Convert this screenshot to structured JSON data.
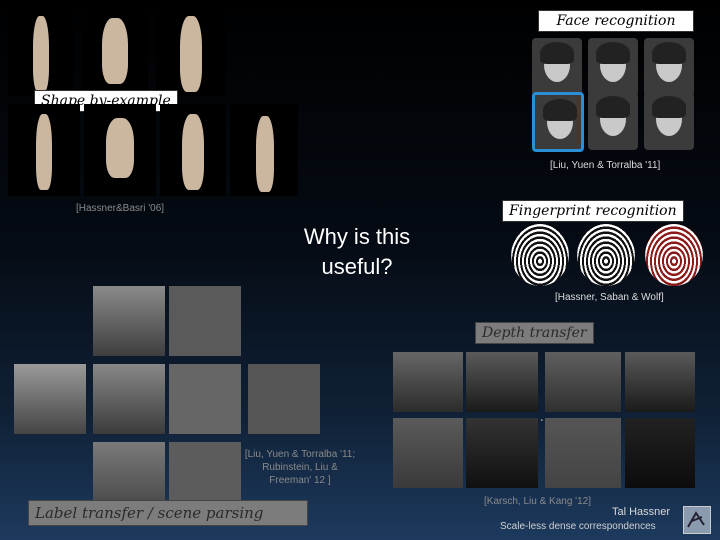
{
  "center_text": "Why is this useful?",
  "shape_example": {
    "caption": "Shape by-example",
    "citation": "[Hassner&Basri '06]"
  },
  "face_recognition": {
    "caption": "Face recognition",
    "citation": "[Liu, Yuen & Torralba '11]"
  },
  "fingerprint": {
    "caption": "Fingerprint recognition",
    "citation": "[Hassner, Saban & Wolf]"
  },
  "depth_transfer": {
    "caption": "Depth transfer",
    "ellipsis": "...",
    "citation": "[Karsch, Liu & Kang '12]"
  },
  "label_transfer": {
    "caption": "Label transfer / scene parsing",
    "citation": "[Liu, Yuen & Torralba '11; Rubinstein, Liu & Freeman' 12 ]"
  },
  "footer": {
    "author": "Tal Hassner",
    "subtitle": "Scale-less dense correspondences"
  }
}
